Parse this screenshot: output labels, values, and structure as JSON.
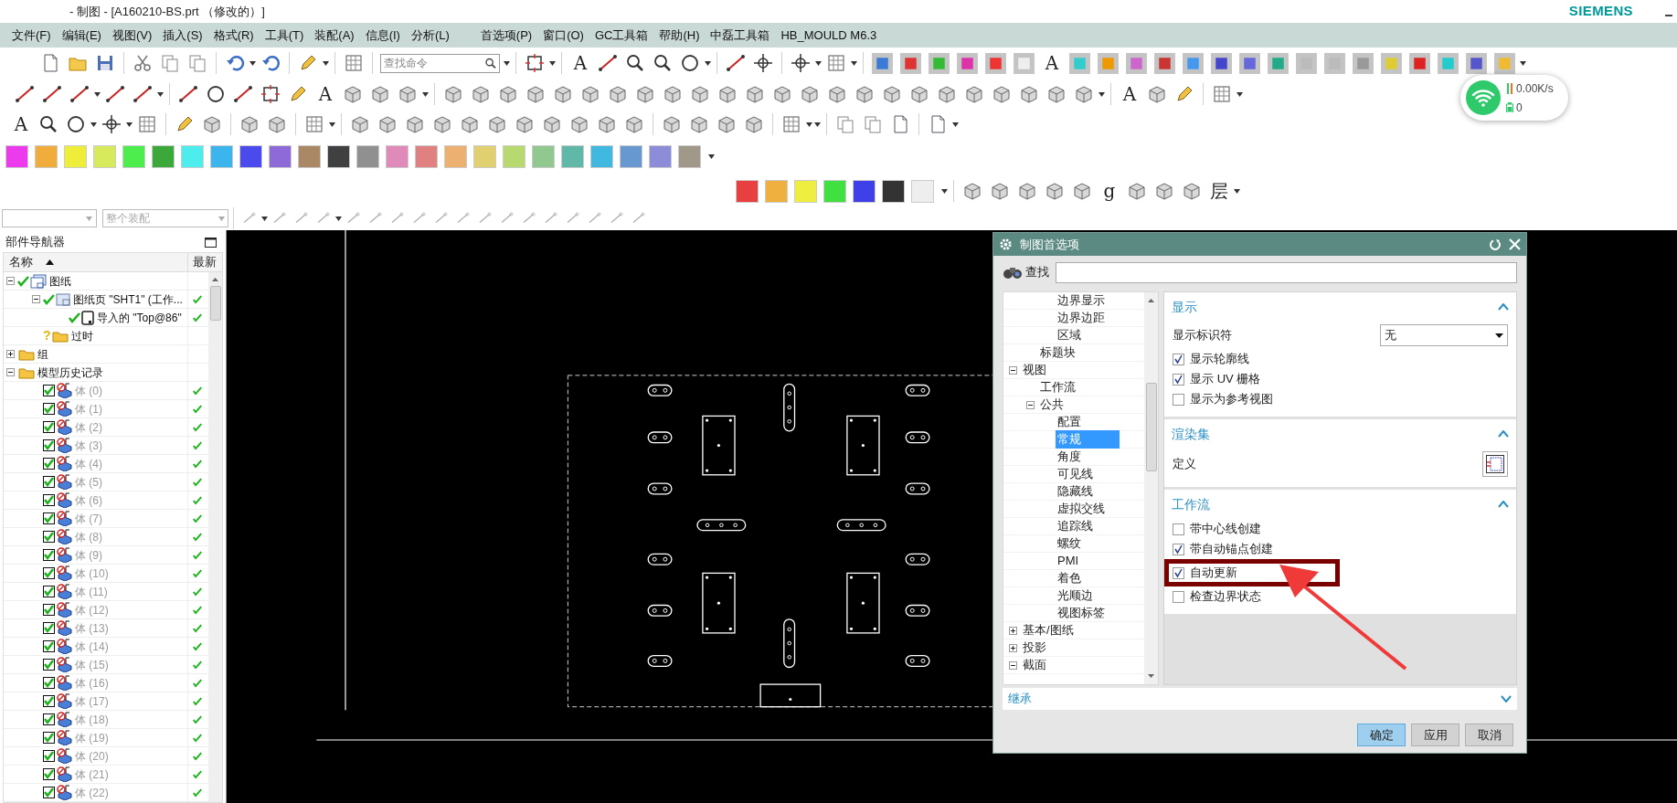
{
  "window": {
    "title": "- 制图 - [A160210-BS.prt （修改的）]",
    "brand": "SIEMENS"
  },
  "menu": [
    "文件(F)",
    "编辑(E)",
    "视图(V)",
    "插入(S)",
    "格式(R)",
    "工具(T)",
    "装配(A)",
    "信息(I)",
    "分析(L)",
    "首选项(P)",
    "窗口(O)",
    "GC工具箱",
    "帮助(H)",
    "中磊工具箱",
    "HB_MOULD M6.3"
  ],
  "toolbar_rows": [
    {
      "glyphs": [
        "A",
        "A"
      ],
      "search": {
        "placeholder": "查找命令"
      }
    },
    {
      "glyphs": [
        "A",
        "A"
      ]
    },
    {
      "glyphs": [
        "A"
      ]
    },
    {
      "swatches": [
        {
          "color": "#ec3bec"
        },
        {
          "color": "#f0ad3c"
        },
        {
          "color": "#eded3a"
        },
        {
          "color": "#d6ea5c"
        },
        {
          "color": "#4ded4d"
        },
        {
          "color": "#3ca83c"
        },
        {
          "color": "#4dedeD"
        },
        {
          "color": "#3cb4ed"
        },
        {
          "color": "#4a4aed"
        },
        {
          "color": "#8e6ad8"
        },
        {
          "color": "#aa8866"
        },
        {
          "color": "#404040"
        },
        {
          "color": "#909090"
        },
        {
          "color": "#e08aba"
        },
        {
          "color": "#e08080"
        },
        {
          "color": "#ecb070"
        },
        {
          "color": "#e0d070"
        },
        {
          "color": "#b8d870"
        },
        {
          "color": "#90c890"
        },
        {
          "color": "#60b8a8"
        },
        {
          "color": "#40b8e0"
        },
        {
          "color": "#6898d0"
        },
        {
          "color": "#8c8cd8"
        },
        {
          "color": "#a09888"
        }
      ]
    },
    {
      "swatches": [
        {
          "color": "#e84040"
        },
        {
          "color": "#f0b040"
        },
        {
          "color": "#eeee40"
        },
        {
          "color": "#40e040"
        },
        {
          "color": "#4040e8"
        },
        {
          "color": "#333333"
        },
        {
          "color": "#eeeeee"
        }
      ],
      "glyphs": [
        "g",
        "层"
      ]
    },
    {
      "dropdown": {
        "value": "整个装配",
        "disabled": true
      }
    }
  ],
  "network_widget": {
    "speed": "0.00K/s",
    "count": "0"
  },
  "part_navigator": {
    "title": "部件导航器",
    "columns": [
      "名称",
      "最新"
    ],
    "tree": [
      {
        "label": "图纸",
        "kind": "drawing",
        "expanded": true,
        "checked": true,
        "children": [
          {
            "label": "图纸页 \"SHT1\" (工作...",
            "kind": "sheet",
            "expanded": true,
            "checked": true,
            "latest": true,
            "children": [
              {
                "label": "导入的 \"Top@86\"",
                "kind": "view",
                "checked": true,
                "latest": true
              }
            ]
          },
          {
            "label": "过时",
            "kind": "outdated",
            "mark": "?"
          }
        ]
      },
      {
        "label": "组",
        "kind": "folder",
        "expanded": false
      },
      {
        "label": "模型历史记录",
        "kind": "folder",
        "expanded": true,
        "children": [
          {
            "label": "体 (0)",
            "kind": "body",
            "checked": true,
            "latest": true
          },
          {
            "label": "体 (1)",
            "kind": "body",
            "checked": true,
            "latest": true
          },
          {
            "label": "体 (2)",
            "kind": "body",
            "checked": true,
            "latest": true
          },
          {
            "label": "体 (3)",
            "kind": "body",
            "checked": true,
            "latest": true
          },
          {
            "label": "体 (4)",
            "kind": "body",
            "checked": true,
            "latest": true
          },
          {
            "label": "体 (5)",
            "kind": "body",
            "checked": true,
            "latest": true
          },
          {
            "label": "体 (6)",
            "kind": "body",
            "checked": true,
            "latest": true
          },
          {
            "label": "体 (7)",
            "kind": "body",
            "checked": true,
            "latest": true
          },
          {
            "label": "体 (8)",
            "kind": "body",
            "checked": true,
            "latest": true
          },
          {
            "label": "体 (9)",
            "kind": "body",
            "checked": true,
            "latest": true
          },
          {
            "label": "体 (10)",
            "kind": "body",
            "checked": true,
            "latest": true
          },
          {
            "label": "体 (11)",
            "kind": "body",
            "checked": true,
            "latest": true
          },
          {
            "label": "体 (12)",
            "kind": "body",
            "checked": true,
            "latest": true
          },
          {
            "label": "体 (13)",
            "kind": "body",
            "checked": true,
            "latest": true
          },
          {
            "label": "体 (14)",
            "kind": "body",
            "checked": true,
            "latest": true
          },
          {
            "label": "体 (15)",
            "kind": "body",
            "checked": true,
            "latest": true
          },
          {
            "label": "体 (16)",
            "kind": "body",
            "checked": true,
            "latest": true
          },
          {
            "label": "体 (17)",
            "kind": "body",
            "checked": true,
            "latest": true
          },
          {
            "label": "体 (18)",
            "kind": "body",
            "checked": true,
            "latest": true
          },
          {
            "label": "体 (19)",
            "kind": "body",
            "checked": true,
            "latest": true
          },
          {
            "label": "体 (20)",
            "kind": "body",
            "checked": true,
            "latest": true
          },
          {
            "label": "体 (21)",
            "kind": "body",
            "checked": true,
            "latest": true
          },
          {
            "label": "体 (22)",
            "kind": "body",
            "checked": true,
            "latest": true
          }
        ]
      }
    ]
  },
  "dialog": {
    "title": "制图首选项",
    "search_label": "查找",
    "tree": [
      {
        "children": [
          {
            "children": [
              {
                "label": "边界显示",
                "selected": false
              },
              {
                "label": "边界边距",
                "selected": false
              },
              {
                "label": "区域",
                "selected": false
              }
            ]
          },
          {
            "label": "标题块",
            "selected": false
          }
        ]
      },
      {
        "label": "视图",
        "expanded": true,
        "selected": false,
        "children": [
          {
            "label": "工作流",
            "selected": false
          },
          {
            "label": "公共",
            "expanded": true,
            "selected": false,
            "children": [
              {
                "label": "配置",
                "selected": false
              },
              {
                "label": "常规",
                "selected": true
              },
              {
                "label": "角度",
                "selected": false
              },
              {
                "label": "可见线",
                "selected": false
              },
              {
                "label": "隐藏线",
                "selected": false
              },
              {
                "label": "虚拟交线",
                "selected": false
              },
              {
                "label": "追踪线",
                "selected": false
              },
              {
                "label": "螺纹",
                "selected": false
              },
              {
                "label": "PMI",
                "selected": false
              },
              {
                "label": "着色",
                "selected": false
              },
              {
                "label": "光顺边",
                "selected": false
              },
              {
                "label": "视图标签",
                "selected": false
              }
            ]
          }
        ]
      },
      {
        "label": "基本/图纸",
        "expanded": false,
        "selected": false
      },
      {
        "label": "投影",
        "expanded": false,
        "selected": false
      },
      {
        "label": "截面",
        "expanded": true,
        "selected": false
      }
    ],
    "sections": [
      {
        "title": "显示",
        "expanded": true,
        "rows": [
          {
            "kind": "select",
            "label": "显示标识符",
            "value": "无"
          },
          {
            "kind": "checkbox",
            "label": "显示轮廓线",
            "checked": true
          },
          {
            "kind": "checkbox",
            "label": "显示 UV 栅格",
            "checked": true
          },
          {
            "kind": "checkbox",
            "label": "显示为参考视图",
            "checked": false
          }
        ]
      },
      {
        "title": "渲染集",
        "expanded": true,
        "rows": [
          {
            "kind": "button",
            "label": "定义"
          }
        ]
      },
      {
        "title": "工作流",
        "expanded": true,
        "rows": [
          {
            "kind": "checkbox",
            "label": "带中心线创建",
            "checked": false
          },
          {
            "kind": "checkbox",
            "label": "带自动锚点创建",
            "checked": true
          },
          {
            "kind": "checkbox",
            "label": "自动更新",
            "checked": true
          },
          {
            "kind": "checkbox",
            "label": "检查边界状态",
            "checked": false
          }
        ]
      }
    ],
    "footer_section": {
      "title": "继承",
      "expanded": false
    },
    "buttons": [
      {
        "label": "确定",
        "default": true
      },
      {
        "label": "应用",
        "default": false
      },
      {
        "label": "取消",
        "default": false
      }
    ]
  }
}
